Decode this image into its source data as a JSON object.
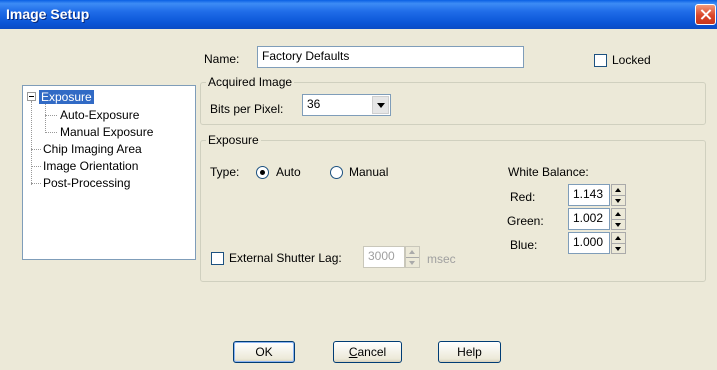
{
  "window": {
    "title": "Image Setup"
  },
  "name": {
    "label": "Name:",
    "value": "Factory Defaults"
  },
  "locked": {
    "label": "Locked",
    "checked": false
  },
  "tree": {
    "items": [
      {
        "label": "Exposure",
        "selected": true,
        "expanded": true
      },
      {
        "label": "Auto-Exposure",
        "selected": false
      },
      {
        "label": "Manual Exposure",
        "selected": false
      },
      {
        "label": "Chip Imaging Area",
        "selected": false
      },
      {
        "label": "Image Orientation",
        "selected": false
      },
      {
        "label": "Post-Processing",
        "selected": false
      }
    ]
  },
  "acquired": {
    "title": "Acquired Image",
    "bits_label": "Bits per Pixel:",
    "bits_value": "36"
  },
  "exposure": {
    "title": "Exposure",
    "type_label": "Type:",
    "type_options": [
      "Auto",
      "Manual"
    ],
    "type_selected": "Auto",
    "white_balance": {
      "title": "White Balance:",
      "red": {
        "label": "Red:",
        "value": "1.143"
      },
      "green": {
        "label": "Green:",
        "value": "1.002"
      },
      "blue": {
        "label": "Blue:",
        "value": "1.000"
      }
    },
    "shutter_lag": {
      "label": "External Shutter Lag:",
      "checked": false,
      "value": "3000",
      "unit": "msec"
    }
  },
  "buttons": {
    "ok": "OK",
    "cancel": "Cancel",
    "help": "Help"
  },
  "colors": {
    "titlebar": "#0a55d6",
    "selection": "#316ac5",
    "dialog_bg": "#ece9d8"
  }
}
